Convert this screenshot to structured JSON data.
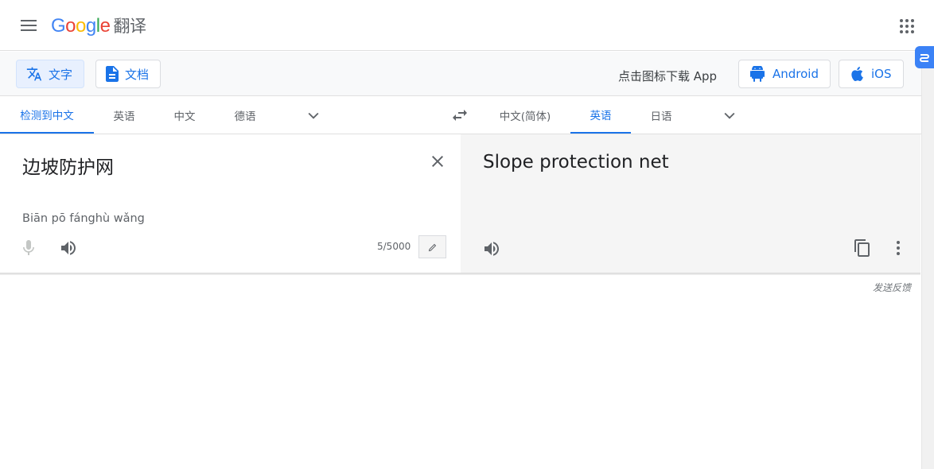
{
  "header": {
    "logo_letters": [
      "G",
      "o",
      "o",
      "g",
      "l",
      "e"
    ],
    "product": "翻译"
  },
  "modebar": {
    "text_label": "文字",
    "docs_label": "文档",
    "app_download": "点击图标下载 App",
    "android_label": "Android",
    "ios_label": "iOS"
  },
  "source_langs": [
    "检测到中文",
    "英语",
    "中文",
    "德语"
  ],
  "target_langs": [
    "中文(简体)",
    "英语",
    "日语"
  ],
  "source": {
    "text": "边坡防护网",
    "pinyin": "Biān pō fánghù wǎng",
    "char_count": "5/5000"
  },
  "target": {
    "text": "Slope protection net"
  },
  "feedback": "发送反馈",
  "colors": {
    "accent": "#1a73e8",
    "active_bg": "#e8f0fe",
    "target_bg": "#f5f5f5"
  }
}
